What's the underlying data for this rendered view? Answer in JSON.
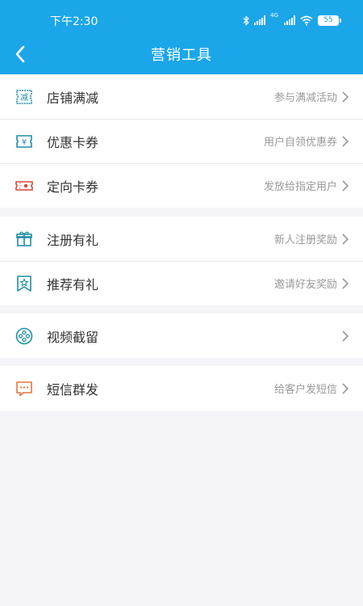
{
  "status_bar": {
    "time": "下午2:30",
    "net_label_1": "4G",
    "net_label_2": "4G",
    "battery": "55"
  },
  "nav": {
    "title": "营销工具",
    "back_icon": "chevron-left-icon"
  },
  "groups": [
    {
      "items": [
        {
          "label": "店铺满减",
          "desc": "参与满减活动",
          "icon": "discount-tag-icon",
          "icon_text": "减"
        },
        {
          "label": "优惠卡券",
          "desc": "用户自领优惠券",
          "icon": "coupon-yen-icon",
          "icon_text": "¥"
        },
        {
          "label": "定向卡券",
          "desc": "发放给指定用户",
          "icon": "ticket-icon",
          "icon_text": ""
        }
      ]
    },
    {
      "items": [
        {
          "label": "注册有礼",
          "desc": "新人注册奖励",
          "icon": "gift-icon",
          "icon_text": ""
        },
        {
          "label": "推荐有礼",
          "desc": "邀请好友奖励",
          "icon": "bookmark-star-icon",
          "icon_text": ""
        }
      ]
    },
    {
      "items": [
        {
          "label": "视频截留",
          "desc": "",
          "icon": "film-reel-icon",
          "icon_text": ""
        }
      ]
    },
    {
      "items": [
        {
          "label": "短信群发",
          "desc": "给客户发短信",
          "icon": "chat-bubble-icon",
          "icon_text": ""
        }
      ]
    }
  ],
  "colors": {
    "header": "#1aa6e9",
    "teal_icon": "#1d8fa6",
    "orange_icon": "#e8743b",
    "red_icon": "#d9473d"
  }
}
